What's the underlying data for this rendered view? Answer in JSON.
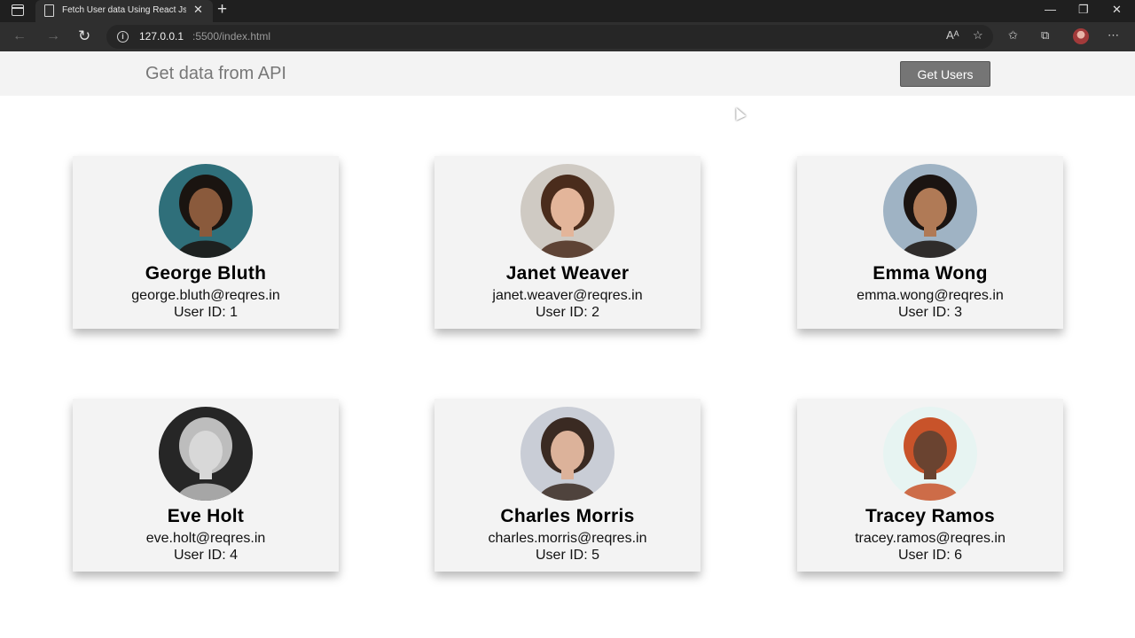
{
  "browser": {
    "tab_title": "Fetch User data Using React Js A",
    "tab_close": "✕",
    "new_tab": "+",
    "url_host": "127.0.0.1",
    "url_path": ":5500/index.html",
    "window_controls": {
      "minimize": "—",
      "restore": "❐",
      "close": "✕"
    },
    "toolbar_icons": [
      "read-aloud-icon",
      "favorite-add-icon",
      "favorites-icon",
      "collections-icon",
      "profile-icon",
      "more-icon"
    ]
  },
  "header": {
    "title": "Get data from API",
    "button_label": "Get Users"
  },
  "users": [
    {
      "name": "George Bluth",
      "email": "george.bluth@reqres.in",
      "id_label": "User ID: 1",
      "bg": "#2f6f7a",
      "skin": "#8a5a3c",
      "hair": "#1a1410"
    },
    {
      "name": "Janet Weaver",
      "email": "janet.weaver@reqres.in",
      "id_label": "User ID: 2",
      "bg": "#cfcac3",
      "skin": "#e3b59a",
      "hair": "#4a2c1c"
    },
    {
      "name": "Emma Wong",
      "email": "emma.wong@reqres.in",
      "id_label": "User ID: 3",
      "bg": "#9fb3c4",
      "skin": "#b07a56",
      "hair": "#1b1411"
    },
    {
      "name": "Eve Holt",
      "email": "eve.holt@reqres.in",
      "id_label": "User ID: 4",
      "bg": "#262626",
      "skin": "#d8d8d8",
      "hair": "#bdbdbd"
    },
    {
      "name": "Charles Morris",
      "email": "charles.morris@reqres.in",
      "id_label": "User ID: 5",
      "bg": "#c9cdd6",
      "skin": "#dcb29a",
      "hair": "#3a2a22"
    },
    {
      "name": "Tracey Ramos",
      "email": "tracey.ramos@reqres.in",
      "id_label": "User ID: 6",
      "bg": "#e7f4f2",
      "skin": "#6a4330",
      "hair": "#c8532a"
    }
  ]
}
